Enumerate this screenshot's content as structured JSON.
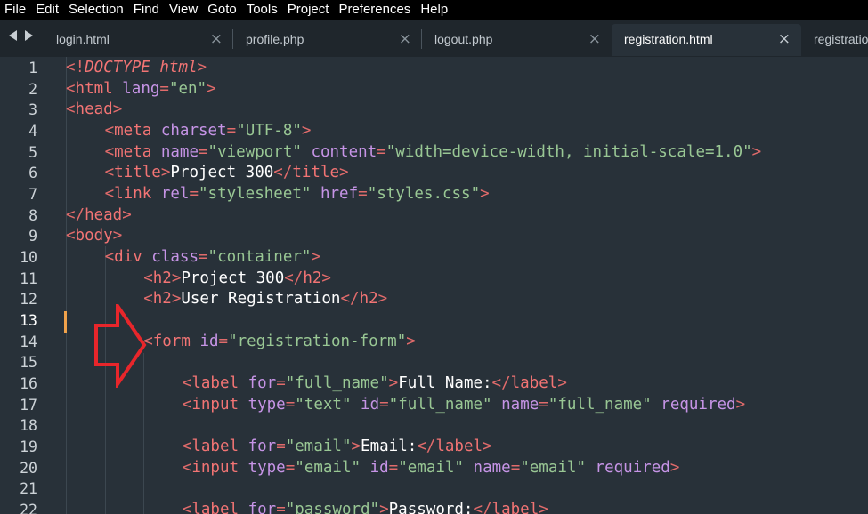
{
  "menu": [
    "File",
    "Edit",
    "Selection",
    "Find",
    "View",
    "Goto",
    "Tools",
    "Project",
    "Preferences",
    "Help"
  ],
  "tabs": [
    {
      "label": "login.html",
      "active": false
    },
    {
      "label": "profile.php",
      "active": false
    },
    {
      "label": "logout.php",
      "active": false
    },
    {
      "label": "registration.html",
      "active": true
    },
    {
      "label": "registratio",
      "active": false
    }
  ],
  "tab_close_glyph": "×",
  "current_line": 13,
  "colors": {
    "tag": "#f27474",
    "attribute": "#c694e6",
    "string": "#99c794",
    "text": "#ffffff",
    "background": "#283139",
    "current_line_marker": "#f0a24b",
    "annotation_arrow": "#e8262b"
  },
  "annotation": {
    "icon": "red-arrow-pointing-right",
    "points_to_line": 14
  },
  "lines": [
    {
      "n": "1",
      "indent": 0,
      "tokens": [
        [
          "p",
          "<!"
        ],
        [
          "i",
          "DOCTYPE"
        ],
        [
          "t",
          " "
        ],
        [
          "i",
          "html"
        ],
        [
          "p",
          ">"
        ]
      ]
    },
    {
      "n": "2",
      "indent": 0,
      "tokens": [
        [
          "p",
          "<"
        ],
        [
          "k",
          "html"
        ],
        [
          "t",
          " "
        ],
        [
          "a",
          "lang"
        ],
        [
          "p",
          "="
        ],
        [
          "s",
          "\"en\""
        ],
        [
          "p",
          ">"
        ]
      ]
    },
    {
      "n": "3",
      "indent": 0,
      "tokens": [
        [
          "p",
          "<"
        ],
        [
          "k",
          "head"
        ],
        [
          "p",
          ">"
        ]
      ]
    },
    {
      "n": "4",
      "indent": 1,
      "tokens": [
        [
          "p",
          "<"
        ],
        [
          "k",
          "meta"
        ],
        [
          "t",
          " "
        ],
        [
          "a",
          "charset"
        ],
        [
          "p",
          "="
        ],
        [
          "s",
          "\"UTF-8\""
        ],
        [
          "p",
          ">"
        ]
      ]
    },
    {
      "n": "5",
      "indent": 1,
      "tokens": [
        [
          "p",
          "<"
        ],
        [
          "k",
          "meta"
        ],
        [
          "t",
          " "
        ],
        [
          "a",
          "name"
        ],
        [
          "p",
          "="
        ],
        [
          "s",
          "\"viewport\""
        ],
        [
          "t",
          " "
        ],
        [
          "a",
          "content"
        ],
        [
          "p",
          "="
        ],
        [
          "s",
          "\"width=device-width, initial-scale=1.0\""
        ],
        [
          "p",
          ">"
        ]
      ]
    },
    {
      "n": "6",
      "indent": 1,
      "tokens": [
        [
          "p",
          "<"
        ],
        [
          "k",
          "title"
        ],
        [
          "p",
          ">"
        ],
        [
          "t",
          "Project 300"
        ],
        [
          "p",
          "</"
        ],
        [
          "k",
          "title"
        ],
        [
          "p",
          ">"
        ]
      ]
    },
    {
      "n": "7",
      "indent": 1,
      "tokens": [
        [
          "p",
          "<"
        ],
        [
          "k",
          "link"
        ],
        [
          "t",
          " "
        ],
        [
          "a",
          "rel"
        ],
        [
          "p",
          "="
        ],
        [
          "s",
          "\"stylesheet\""
        ],
        [
          "t",
          " "
        ],
        [
          "a",
          "href"
        ],
        [
          "p",
          "="
        ],
        [
          "s",
          "\"styles.css\""
        ],
        [
          "p",
          ">"
        ]
      ]
    },
    {
      "n": "8",
      "indent": 0,
      "tokens": [
        [
          "p",
          "</"
        ],
        [
          "k",
          "head"
        ],
        [
          "p",
          ">"
        ]
      ]
    },
    {
      "n": "9",
      "indent": 0,
      "tokens": [
        [
          "p",
          "<"
        ],
        [
          "k",
          "body"
        ],
        [
          "p",
          ">"
        ]
      ]
    },
    {
      "n": "10",
      "indent": 1,
      "tokens": [
        [
          "p",
          "<"
        ],
        [
          "k",
          "div"
        ],
        [
          "t",
          " "
        ],
        [
          "a",
          "class"
        ],
        [
          "p",
          "="
        ],
        [
          "s",
          "\"container\""
        ],
        [
          "p",
          ">"
        ]
      ]
    },
    {
      "n": "11",
      "indent": 2,
      "tokens": [
        [
          "p",
          "<"
        ],
        [
          "k",
          "h2"
        ],
        [
          "p",
          ">"
        ],
        [
          "t",
          "Project 300"
        ],
        [
          "p",
          "</"
        ],
        [
          "k",
          "h2"
        ],
        [
          "p",
          ">"
        ]
      ]
    },
    {
      "n": "12",
      "indent": 2,
      "tokens": [
        [
          "p",
          "<"
        ],
        [
          "k",
          "h2"
        ],
        [
          "p",
          ">"
        ],
        [
          "t",
          "User Registration"
        ],
        [
          "p",
          "</"
        ],
        [
          "k",
          "h2"
        ],
        [
          "p",
          ">"
        ]
      ]
    },
    {
      "n": "13",
      "indent": 0,
      "tokens": []
    },
    {
      "n": "14",
      "indent": 2,
      "tokens": [
        [
          "p",
          "<"
        ],
        [
          "k",
          "form"
        ],
        [
          "t",
          " "
        ],
        [
          "a",
          "id"
        ],
        [
          "p",
          "="
        ],
        [
          "s",
          "\"registration-form\""
        ],
        [
          "p",
          ">"
        ]
      ]
    },
    {
      "n": "15",
      "indent": 0,
      "tokens": []
    },
    {
      "n": "16",
      "indent": 3,
      "tokens": [
        [
          "p",
          "<"
        ],
        [
          "k",
          "label"
        ],
        [
          "t",
          " "
        ],
        [
          "a",
          "for"
        ],
        [
          "p",
          "="
        ],
        [
          "s",
          "\"full_name\""
        ],
        [
          "p",
          ">"
        ],
        [
          "t",
          "Full Name:"
        ],
        [
          "p",
          "</"
        ],
        [
          "k",
          "label"
        ],
        [
          "p",
          ">"
        ]
      ]
    },
    {
      "n": "17",
      "indent": 3,
      "tokens": [
        [
          "p",
          "<"
        ],
        [
          "k",
          "input"
        ],
        [
          "t",
          " "
        ],
        [
          "a",
          "type"
        ],
        [
          "p",
          "="
        ],
        [
          "s",
          "\"text\""
        ],
        [
          "t",
          " "
        ],
        [
          "a",
          "id"
        ],
        [
          "p",
          "="
        ],
        [
          "s",
          "\"full_name\""
        ],
        [
          "t",
          " "
        ],
        [
          "a",
          "name"
        ],
        [
          "p",
          "="
        ],
        [
          "s",
          "\"full_name\""
        ],
        [
          "t",
          " "
        ],
        [
          "a",
          "required"
        ],
        [
          "p",
          ">"
        ]
      ]
    },
    {
      "n": "18",
      "indent": 0,
      "tokens": []
    },
    {
      "n": "19",
      "indent": 3,
      "tokens": [
        [
          "p",
          "<"
        ],
        [
          "k",
          "label"
        ],
        [
          "t",
          " "
        ],
        [
          "a",
          "for"
        ],
        [
          "p",
          "="
        ],
        [
          "s",
          "\"email\""
        ],
        [
          "p",
          ">"
        ],
        [
          "t",
          "Email:"
        ],
        [
          "p",
          "</"
        ],
        [
          "k",
          "label"
        ],
        [
          "p",
          ">"
        ]
      ]
    },
    {
      "n": "20",
      "indent": 3,
      "tokens": [
        [
          "p",
          "<"
        ],
        [
          "k",
          "input"
        ],
        [
          "t",
          " "
        ],
        [
          "a",
          "type"
        ],
        [
          "p",
          "="
        ],
        [
          "s",
          "\"email\""
        ],
        [
          "t",
          " "
        ],
        [
          "a",
          "id"
        ],
        [
          "p",
          "="
        ],
        [
          "s",
          "\"email\""
        ],
        [
          "t",
          " "
        ],
        [
          "a",
          "name"
        ],
        [
          "p",
          "="
        ],
        [
          "s",
          "\"email\""
        ],
        [
          "t",
          " "
        ],
        [
          "a",
          "required"
        ],
        [
          "p",
          ">"
        ]
      ]
    },
    {
      "n": "21",
      "indent": 0,
      "tokens": []
    },
    {
      "n": "22",
      "indent": 3,
      "tokens": [
        [
          "p",
          "<"
        ],
        [
          "k",
          "label"
        ],
        [
          "t",
          " "
        ],
        [
          "a",
          "for"
        ],
        [
          "p",
          "="
        ],
        [
          "s",
          "\"password\""
        ],
        [
          "p",
          ">"
        ],
        [
          "t",
          "Password:"
        ],
        [
          "p",
          "</"
        ],
        [
          "k",
          "label"
        ],
        [
          "p",
          ">"
        ]
      ]
    }
  ]
}
